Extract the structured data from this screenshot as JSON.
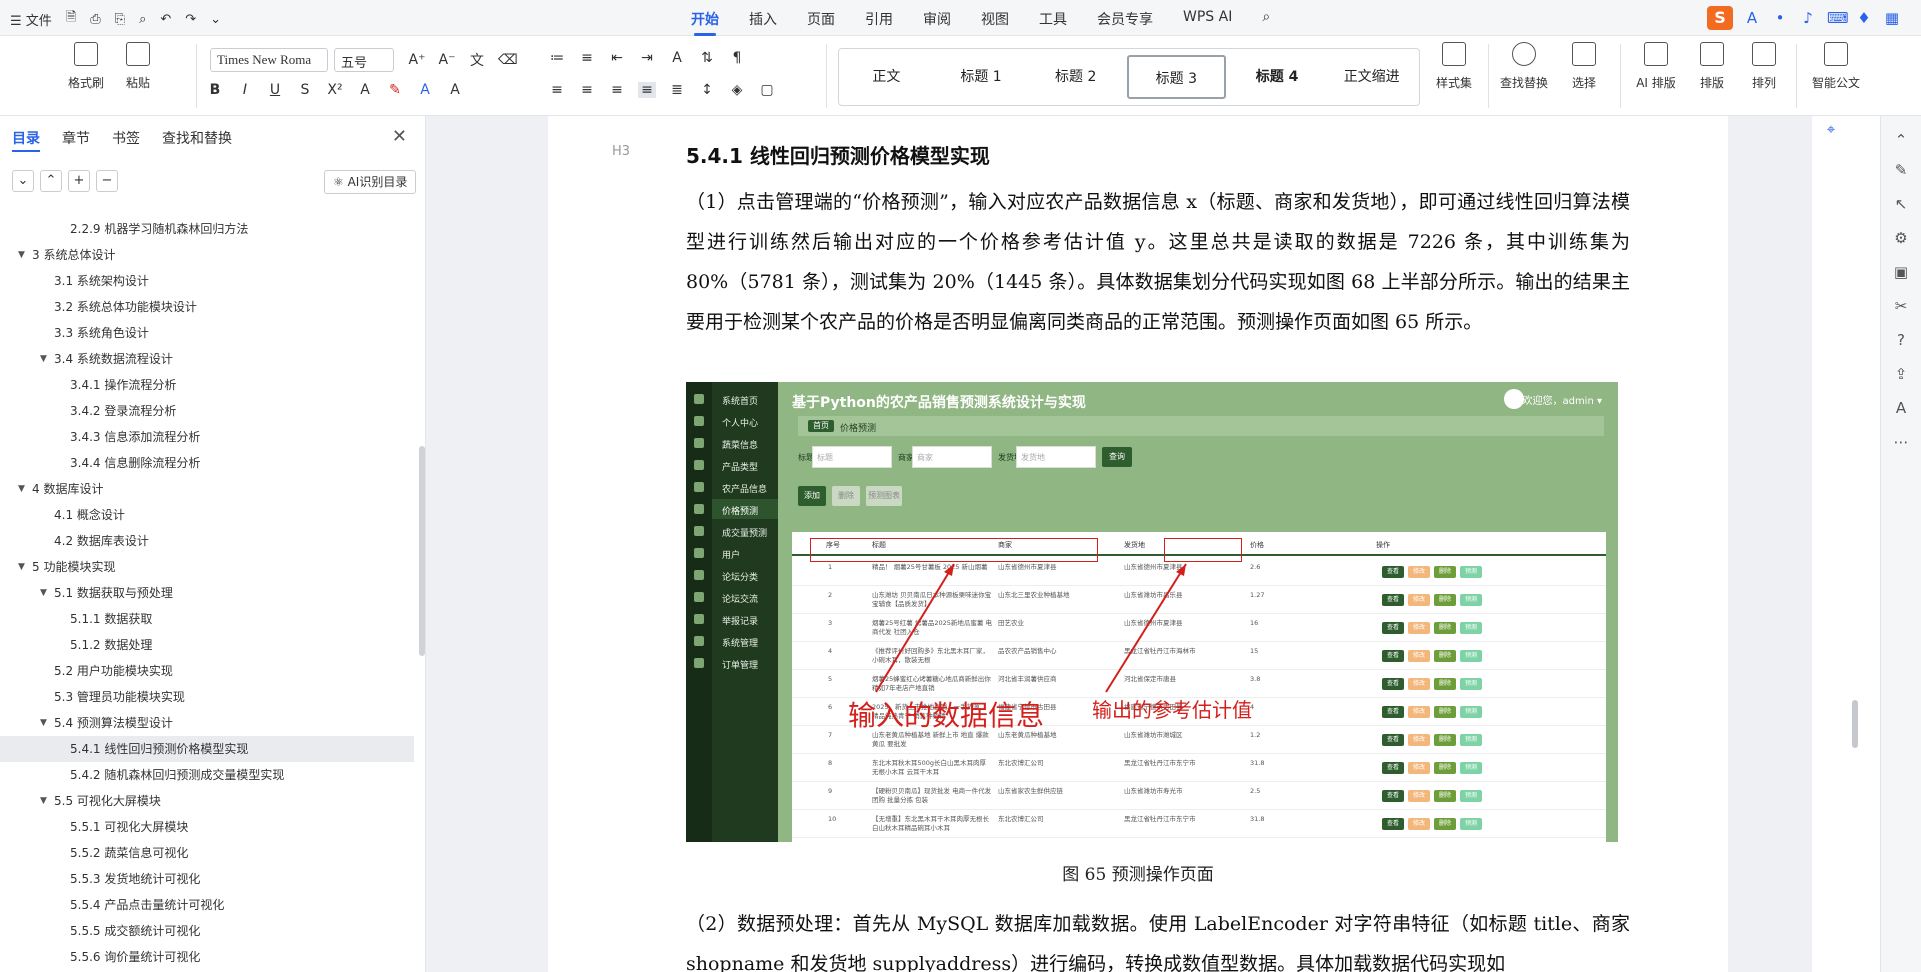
{
  "menubar": {
    "menu_icon": "☰",
    "file_label": "文件",
    "tabs": [
      "开始",
      "插入",
      "页面",
      "引用",
      "审阅",
      "视图",
      "工具",
      "会员专享",
      "WPS AI"
    ],
    "active_tab": "开始"
  },
  "ribbon": {
    "format_painter": "格式刷",
    "paste": "粘贴",
    "font_name": "Times New Roma",
    "font_size": "五号",
    "styles": [
      "正文",
      "标题 1",
      "标题 2",
      "标题 3",
      "标题 4",
      "正文缩进"
    ],
    "selected_style": "标题 3",
    "style_set": "样式集",
    "find_replace": "查找替换",
    "select": "选择",
    "ai_layout": "AI 排版",
    "layout": "排版",
    "arrange": "排列",
    "smart_doc": "智能公文"
  },
  "navpane": {
    "tabs": [
      "目录",
      "章节",
      "书签",
      "查找和替换"
    ],
    "active_tab": "目录",
    "ai_toc_label": "AI识别目录",
    "toc": [
      {
        "label": "2.2.9 机器学习随机森林回归方法",
        "level": 3,
        "arrow": ""
      },
      {
        "label": "3 系统总体设计",
        "level": 1,
        "arrow": "▼"
      },
      {
        "label": "3.1 系统架构设计",
        "level": 2,
        "arrow": ""
      },
      {
        "label": "3.2 系统总体功能模块设计",
        "level": 2,
        "arrow": ""
      },
      {
        "label": "3.3 系统角色设计",
        "level": 2,
        "arrow": ""
      },
      {
        "label": "3.4 系统数据流程设计",
        "level": 2,
        "arrow": "▼"
      },
      {
        "label": "3.4.1 操作流程分析",
        "level": 3,
        "arrow": ""
      },
      {
        "label": "3.4.2 登录流程分析",
        "level": 3,
        "arrow": ""
      },
      {
        "label": "3.4.3 信息添加流程分析",
        "level": 3,
        "arrow": ""
      },
      {
        "label": "3.4.4 信息删除流程分析",
        "level": 3,
        "arrow": ""
      },
      {
        "label": "4 数据库设计",
        "level": 1,
        "arrow": "▼"
      },
      {
        "label": "4.1 概念设计",
        "level": 2,
        "arrow": ""
      },
      {
        "label": "4.2 数据库表设计",
        "level": 2,
        "arrow": ""
      },
      {
        "label": "5 功能模块实现",
        "level": 1,
        "arrow": "▼"
      },
      {
        "label": "5.1 数据获取与预处理",
        "level": 2,
        "arrow": "▼"
      },
      {
        "label": "5.1.1 数据获取",
        "level": 3,
        "arrow": ""
      },
      {
        "label": "5.1.2 数据处理",
        "level": 3,
        "arrow": ""
      },
      {
        "label": "5.2 用户功能模块实现",
        "level": 2,
        "arrow": ""
      },
      {
        "label": "5.3 管理员功能模块实现",
        "level": 2,
        "arrow": ""
      },
      {
        "label": "5.4 预测算法模型设计",
        "level": 2,
        "arrow": "▼"
      },
      {
        "label": "5.4.1 线性回归预测价格模型实现",
        "level": 3,
        "arrow": "",
        "active": true
      },
      {
        "label": "5.4.2 随机森林回归预测成交量模型实现",
        "level": 3,
        "arrow": ""
      },
      {
        "label": "5.5 可视化大屏模块",
        "level": 2,
        "arrow": "▼"
      },
      {
        "label": "5.5.1 可视化大屏模块",
        "level": 3,
        "arrow": ""
      },
      {
        "label": "5.5.2 蔬菜信息可视化",
        "level": 3,
        "arrow": ""
      },
      {
        "label": "5.5.3 发货地统计可视化",
        "level": 3,
        "arrow": ""
      },
      {
        "label": "5.5.4 产品点击量统计可视化",
        "level": 3,
        "arrow": ""
      },
      {
        "label": "5.5.5 成交额统计可视化",
        "level": 3,
        "arrow": ""
      },
      {
        "label": "5.5.6 询价量统计可视化",
        "level": 3,
        "arrow": ""
      }
    ]
  },
  "document": {
    "heading": "5.4.1  线性回归预测价格模型实现",
    "heading_marker": "H3",
    "para1": "（1）点击管理端的“价格预测”，输入对应农产品数据信息 x（标题、商家和发货地），即可通过线性回归算法模型进行训练然后输出对应的一个价格参考估计值 y。这里总共是读取的数据是 7226 条，其中训练集为 80%（5781 条），测试集为 20%（1445 条）。具体数据集划分代码实现如图 68 上半部分所示。输出的结果主要用于检测某个农产品的价格是否明显偏离同类商品的正常范围。预测操作页面如图 65 所示。",
    "caption": "图 65  预测操作页面",
    "para2": "（2）数据预处理：首先从 MySQL 数据库加载数据。使用 LabelEncoder 对字符串特征（如标题 title、商家 shopname 和发货地 supplyaddress）进行编码，转换成数值型数据。具体加载数据代码实现如"
  },
  "figure": {
    "title": "基于Python的农产品销售预测系统设计与实现",
    "user": "欢迎您，admin ▾",
    "breadcrumb_home": "首页",
    "breadcrumb_current": "价格预测",
    "menu": [
      "系统首页",
      "个人中心",
      "蔬菜信息",
      "产品类型",
      "农产品信息",
      "价格预测",
      "成交量预测",
      "用户",
      "论坛分类",
      "论坛交流",
      "举报记录",
      "系统管理",
      "订单管理"
    ],
    "active_menu": "价格预测",
    "search_labels": [
      "标题",
      "商家",
      "发货地"
    ],
    "search_placeholders": [
      "标题",
      "商家",
      "发货地"
    ],
    "search_button": "查询",
    "action_buttons": [
      "添加",
      "删除",
      "预测图表"
    ],
    "headers": [
      "序号",
      "标题",
      "商家",
      "发货地",
      "价格",
      "操作"
    ],
    "row_actions": [
      "查看",
      "修改",
      "删除",
      "预测"
    ],
    "rows": [
      {
        "no": "1",
        "title": "精品！ 烟薯25号甘薯板 2025 新山烟薯",
        "shop": "山东省德州市夏津县",
        "addr": "山东省德州市夏津县",
        "price": "2.6"
      },
      {
        "no": "2",
        "title": "山东潍坊 贝贝南瓜日本种源板栗味迷你宝宝辅食【品质发货】",
        "shop": "山东北三里农业种植基地",
        "addr": "山东省潍坊市昌乐县",
        "price": "1.27"
      },
      {
        "no": "3",
        "title": "烟薯25号红薯 烤薯品2025新地瓜蜜薯 电商代发 社团入仓",
        "shop": "田艺农业",
        "addr": "山东省德州市夏津县",
        "price": "16"
      },
      {
        "no": "4",
        "title": "《推荐评价好回购多》东北黑木耳厂家，小碗木耳，散装无根",
        "shop": "品农农产品销售中心",
        "addr": "黑龙江省牡丹江市海林市",
        "price": "15"
      },
      {
        "no": "5",
        "title": "烟薯25蜂蜜红心烤薯糖心地瓜商新鲜出你精如7年老店产地直销",
        "shop": "河北省丰润薯供应商",
        "addr": "河北省保定市唐县",
        "price": "3.8"
      },
      {
        "no": "6",
        "title": "2025、新货上市推地直销、一手货源、精品纯熟青宁 销售种植精",
        "shop": "福建省宁德市古田县",
        "addr": "福建省宁德市古田县",
        "price": "4"
      },
      {
        "no": "7",
        "title": "山东老黄瓜种植基地 新鲜上市 地直 爆款黄瓜 要批发",
        "shop": "山东老黄瓜种植基地",
        "addr": "山东省潍坊市潍城区",
        "price": "1.2"
      },
      {
        "no": "8",
        "title": "东北木耳秋木耳500g长白山黑木耳肉厚无根小木耳 云耳干木耳",
        "shop": "东北农博汇公司",
        "addr": "黑龙江省牡丹江市东宁市",
        "price": "31.8"
      },
      {
        "no": "9",
        "title": "【硬粉贝贝南瓜】现货批发 电商一件代发 团购 批量分拣 包装",
        "shop": "山东省家农生鲜供应链",
        "addr": "山东省潍坊市寿光市",
        "price": "2.5"
      },
      {
        "no": "10",
        "title": "【无增重】东北黑木耳干木耳肉厚无根长白山秋木耳精品碗耳小木耳",
        "shop": "东北农博汇公司",
        "addr": "黑龙江省牡丹江市东宁市",
        "price": "31.8"
      }
    ],
    "annot_input": "输入的数据信息",
    "annot_output": "输出的参考估计值"
  }
}
